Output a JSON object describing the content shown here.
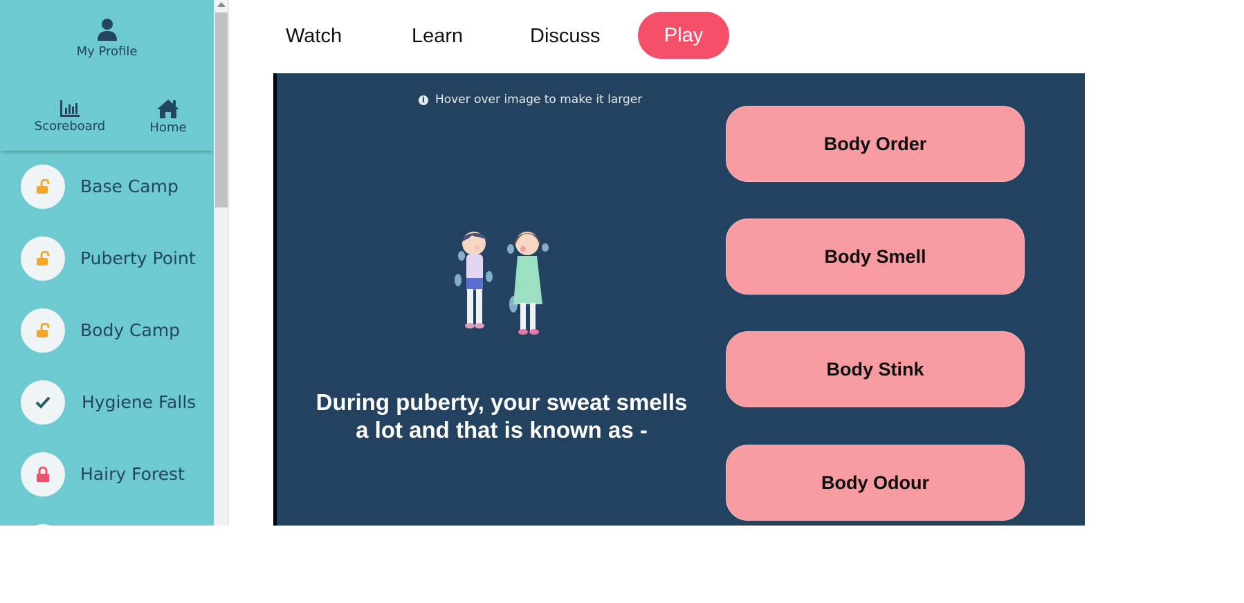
{
  "sidebar": {
    "profile_label": "My Profile",
    "scoreboard_label": "Scoreboard",
    "home_label": "Home",
    "levels": [
      {
        "name": "Base Camp",
        "status": "unlocked",
        "icon": "lock-open-icon"
      },
      {
        "name": "Puberty Point",
        "status": "unlocked",
        "icon": "lock-open-icon"
      },
      {
        "name": "Body Camp",
        "status": "unlocked",
        "icon": "lock-open-icon"
      },
      {
        "name": "Hygiene Falls",
        "status": "completed",
        "icon": "check-icon"
      },
      {
        "name": "Hairy Forest",
        "status": "locked",
        "icon": "lock-closed-icon"
      }
    ]
  },
  "tabs": {
    "watch": "Watch",
    "learn": "Learn",
    "discuss": "Discuss",
    "play": "Play",
    "active": "Play"
  },
  "quiz": {
    "hint": "Hover over image to make it larger",
    "question": "During puberty, your sweat smells a lot and that is known as -",
    "options": [
      "Body Order",
      "Body Smell",
      "Body Stink",
      "Body Odour"
    ]
  },
  "colors": {
    "sidebar_bg": "#6dcad0",
    "panel_bg": "#224260",
    "play_tab": "#f4506a",
    "option_bg": "#f99ca2",
    "unlocked_icon": "#f5a623",
    "locked_icon": "#f4506a",
    "check_icon": "#2e5a6e"
  }
}
